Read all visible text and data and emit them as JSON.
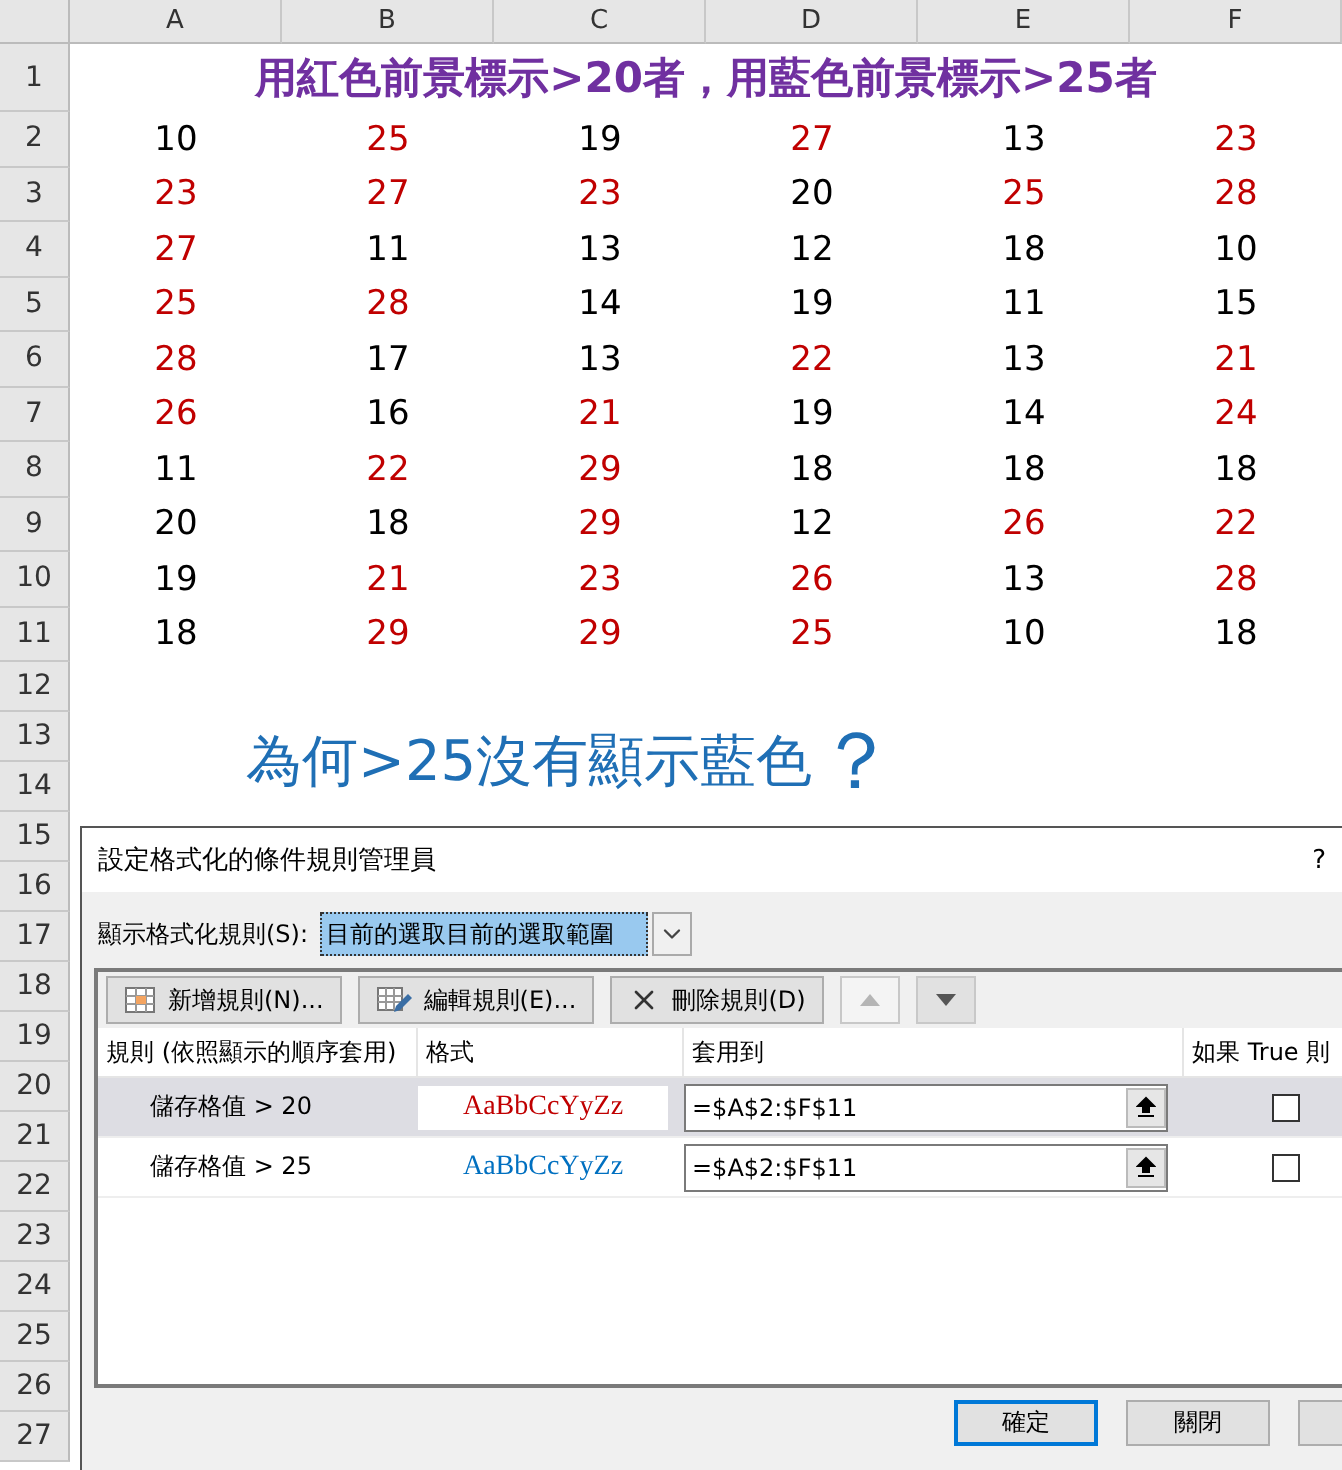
{
  "column_headers": [
    "A",
    "B",
    "C",
    "D",
    "E",
    "F"
  ],
  "row_headers": [
    "1",
    "2",
    "3",
    "4",
    "5",
    "6",
    "7",
    "8",
    "9",
    "10",
    "11",
    "12",
    "13",
    "14",
    "15",
    "16",
    "17",
    "18",
    "19",
    "20",
    "21",
    "22",
    "23",
    "24",
    "25",
    "26",
    "27"
  ],
  "title": "用紅色前景標示>20者，用藍色前景標示>25者",
  "rows": [
    [
      {
        "value": "10",
        "color": "#000000"
      },
      {
        "value": "25",
        "color": "#c00000"
      },
      {
        "value": "19",
        "color": "#000000"
      },
      {
        "value": "27",
        "color": "#c00000"
      },
      {
        "value": "13",
        "color": "#000000"
      },
      {
        "value": "23",
        "color": "#c00000"
      }
    ],
    [
      {
        "value": "23",
        "color": "#c00000"
      },
      {
        "value": "27",
        "color": "#c00000"
      },
      {
        "value": "23",
        "color": "#c00000"
      },
      {
        "value": "20",
        "color": "#000000"
      },
      {
        "value": "25",
        "color": "#c00000"
      },
      {
        "value": "28",
        "color": "#c00000"
      }
    ],
    [
      {
        "value": "27",
        "color": "#c00000"
      },
      {
        "value": "11",
        "color": "#000000"
      },
      {
        "value": "13",
        "color": "#000000"
      },
      {
        "value": "12",
        "color": "#000000"
      },
      {
        "value": "18",
        "color": "#000000"
      },
      {
        "value": "10",
        "color": "#000000"
      }
    ],
    [
      {
        "value": "25",
        "color": "#c00000"
      },
      {
        "value": "28",
        "color": "#c00000"
      },
      {
        "value": "14",
        "color": "#000000"
      },
      {
        "value": "19",
        "color": "#000000"
      },
      {
        "value": "11",
        "color": "#000000"
      },
      {
        "value": "15",
        "color": "#000000"
      }
    ],
    [
      {
        "value": "28",
        "color": "#c00000"
      },
      {
        "value": "17",
        "color": "#000000"
      },
      {
        "value": "13",
        "color": "#000000"
      },
      {
        "value": "22",
        "color": "#c00000"
      },
      {
        "value": "13",
        "color": "#000000"
      },
      {
        "value": "21",
        "color": "#c00000"
      }
    ],
    [
      {
        "value": "26",
        "color": "#c00000"
      },
      {
        "value": "16",
        "color": "#000000"
      },
      {
        "value": "21",
        "color": "#c00000"
      },
      {
        "value": "19",
        "color": "#000000"
      },
      {
        "value": "14",
        "color": "#000000"
      },
      {
        "value": "24",
        "color": "#c00000"
      }
    ],
    [
      {
        "value": "11",
        "color": "#000000"
      },
      {
        "value": "22",
        "color": "#c00000"
      },
      {
        "value": "29",
        "color": "#c00000"
      },
      {
        "value": "18",
        "color": "#000000"
      },
      {
        "value": "18",
        "color": "#000000"
      },
      {
        "value": "18",
        "color": "#000000"
      }
    ],
    [
      {
        "value": "20",
        "color": "#000000"
      },
      {
        "value": "18",
        "color": "#000000"
      },
      {
        "value": "29",
        "color": "#c00000"
      },
      {
        "value": "12",
        "color": "#000000"
      },
      {
        "value": "26",
        "color": "#c00000"
      },
      {
        "value": "22",
        "color": "#c00000"
      }
    ],
    [
      {
        "value": "19",
        "color": "#000000"
      },
      {
        "value": "21",
        "color": "#c00000"
      },
      {
        "value": "23",
        "color": "#c00000"
      },
      {
        "value": "26",
        "color": "#c00000"
      },
      {
        "value": "13",
        "color": "#000000"
      },
      {
        "value": "28",
        "color": "#c00000"
      }
    ],
    [
      {
        "value": "18",
        "color": "#000000"
      },
      {
        "value": "29",
        "color": "#c00000"
      },
      {
        "value": "29",
        "color": "#c00000"
      },
      {
        "value": "25",
        "color": "#c00000"
      },
      {
        "value": "10",
        "color": "#000000"
      },
      {
        "value": "18",
        "color": "#000000"
      }
    ]
  ],
  "question": {
    "text": "為何>25沒有顯示藍色",
    "mark": "？"
  },
  "dialog": {
    "title": "設定格式化的條件規則管理員",
    "help": "?",
    "show_label": "顯示格式化規則(S):",
    "scope": "目前的選取目前的選取範圍",
    "toolbar": [
      {
        "kind": "new",
        "label": "新增規則(N)...",
        "disabled": false
      },
      {
        "kind": "edit",
        "label": "編輯規則(E)...",
        "disabled": false
      },
      {
        "kind": "delete",
        "label": "刪除規則(D)",
        "disabled": false
      },
      {
        "kind": "up",
        "disabled": true
      },
      {
        "kind": "down",
        "disabled": false
      }
    ],
    "columns": [
      "規則 (依照顯示的順序套用)",
      "格式",
      "套用到",
      "如果 True 則"
    ],
    "rules": [
      {
        "rule": "儲存格值 > 20",
        "preview": "AaBbCcYyZz",
        "color": "#c00000",
        "applies_to": "=$A$2:$F$11",
        "stop_if_true": false,
        "selected": true
      },
      {
        "rule": "儲存格值 > 25",
        "preview": "AaBbCcYyZz",
        "color": "#0070c0",
        "applies_to": "=$A$2:$F$11",
        "stop_if_true": false,
        "selected": false
      }
    ],
    "buttons": [
      {
        "label": "確定",
        "focused": true
      },
      {
        "label": "關閉",
        "focused": false
      },
      {
        "focused": false
      }
    ]
  }
}
